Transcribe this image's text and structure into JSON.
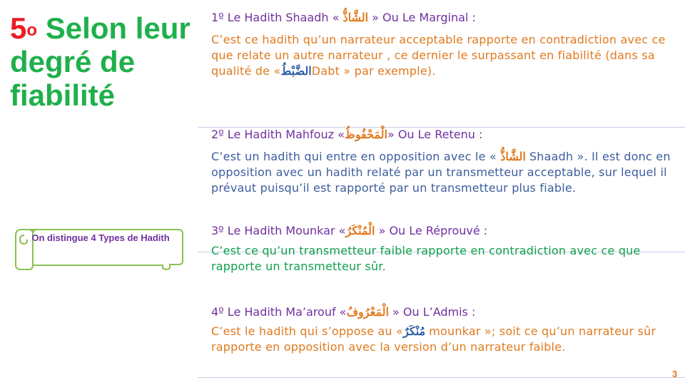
{
  "slide_title": {
    "number": "5",
    "degree": "o",
    "text": "Selon leur degré de fiabilité"
  },
  "callout": {
    "text": "On distingue 4 Types de Hadith"
  },
  "sections": [
    {
      "heading_prefix": "1º Le Hadith Shaadh «",
      "heading_arabic": "الشَّاذُّ",
      "heading_suffix": "» Ou Le Marginal :",
      "body_before": "C’est ce hadith qu’un narrateur acceptable rapporte en contradiction avec ce que relate un autre narrateur , ce dernier le surpassant en fiabilité (dans sa qualité de «",
      "body_arabic": "الضَّبْطُ",
      "body_after": "Dabt » par exemple)."
    },
    {
      "heading_prefix": "2º Le Hadith Mahfouz «",
      "heading_arabic": "الْمَحْفُوظُ",
      "heading_suffix": "» Ou Le Retenu :",
      "body_before": "C’est un hadith qui entre en opposition avec le «",
      "body_arabic": "الشَّاذُّ",
      "body_after": "Shaadh ». Il est donc en opposition avec un hadith relaté par un transmetteur acceptable, sur lequel il prévaut puisqu’il est rapporté par un transmetteur plus fiable."
    },
    {
      "heading_prefix": "3º Le Hadith Mounkar «",
      "heading_arabic": "الْمُنْكَرُ",
      "heading_suffix": "» Ou Le Réprouvé :",
      "body": "C’est ce qu’un transmetteur faible rapporte en contradiction avec ce que rapporte un transmetteur sûr."
    },
    {
      "heading_prefix": "4º Le Hadith Ma’arouf «",
      "heading_arabic": "الْمَعْرُوفُ",
      "heading_suffix": "» Ou L’Admis :",
      "body_before": "C’est le hadith qui s’oppose au «",
      "body_arabic": "مُنْكَرٌ",
      "body_after": "mounkar »; soit ce qu’un narrateur sûr rapporte en opposition avec la version d’un narrateur faible."
    }
  ],
  "page_number": "3",
  "colors": {
    "title_green": "#1fb04b",
    "number_red": "#ec1c24",
    "heading_purple": "#7030a0",
    "orange": "#e07a1f",
    "blue": "#3d5e9e",
    "green": "#11a04c"
  }
}
